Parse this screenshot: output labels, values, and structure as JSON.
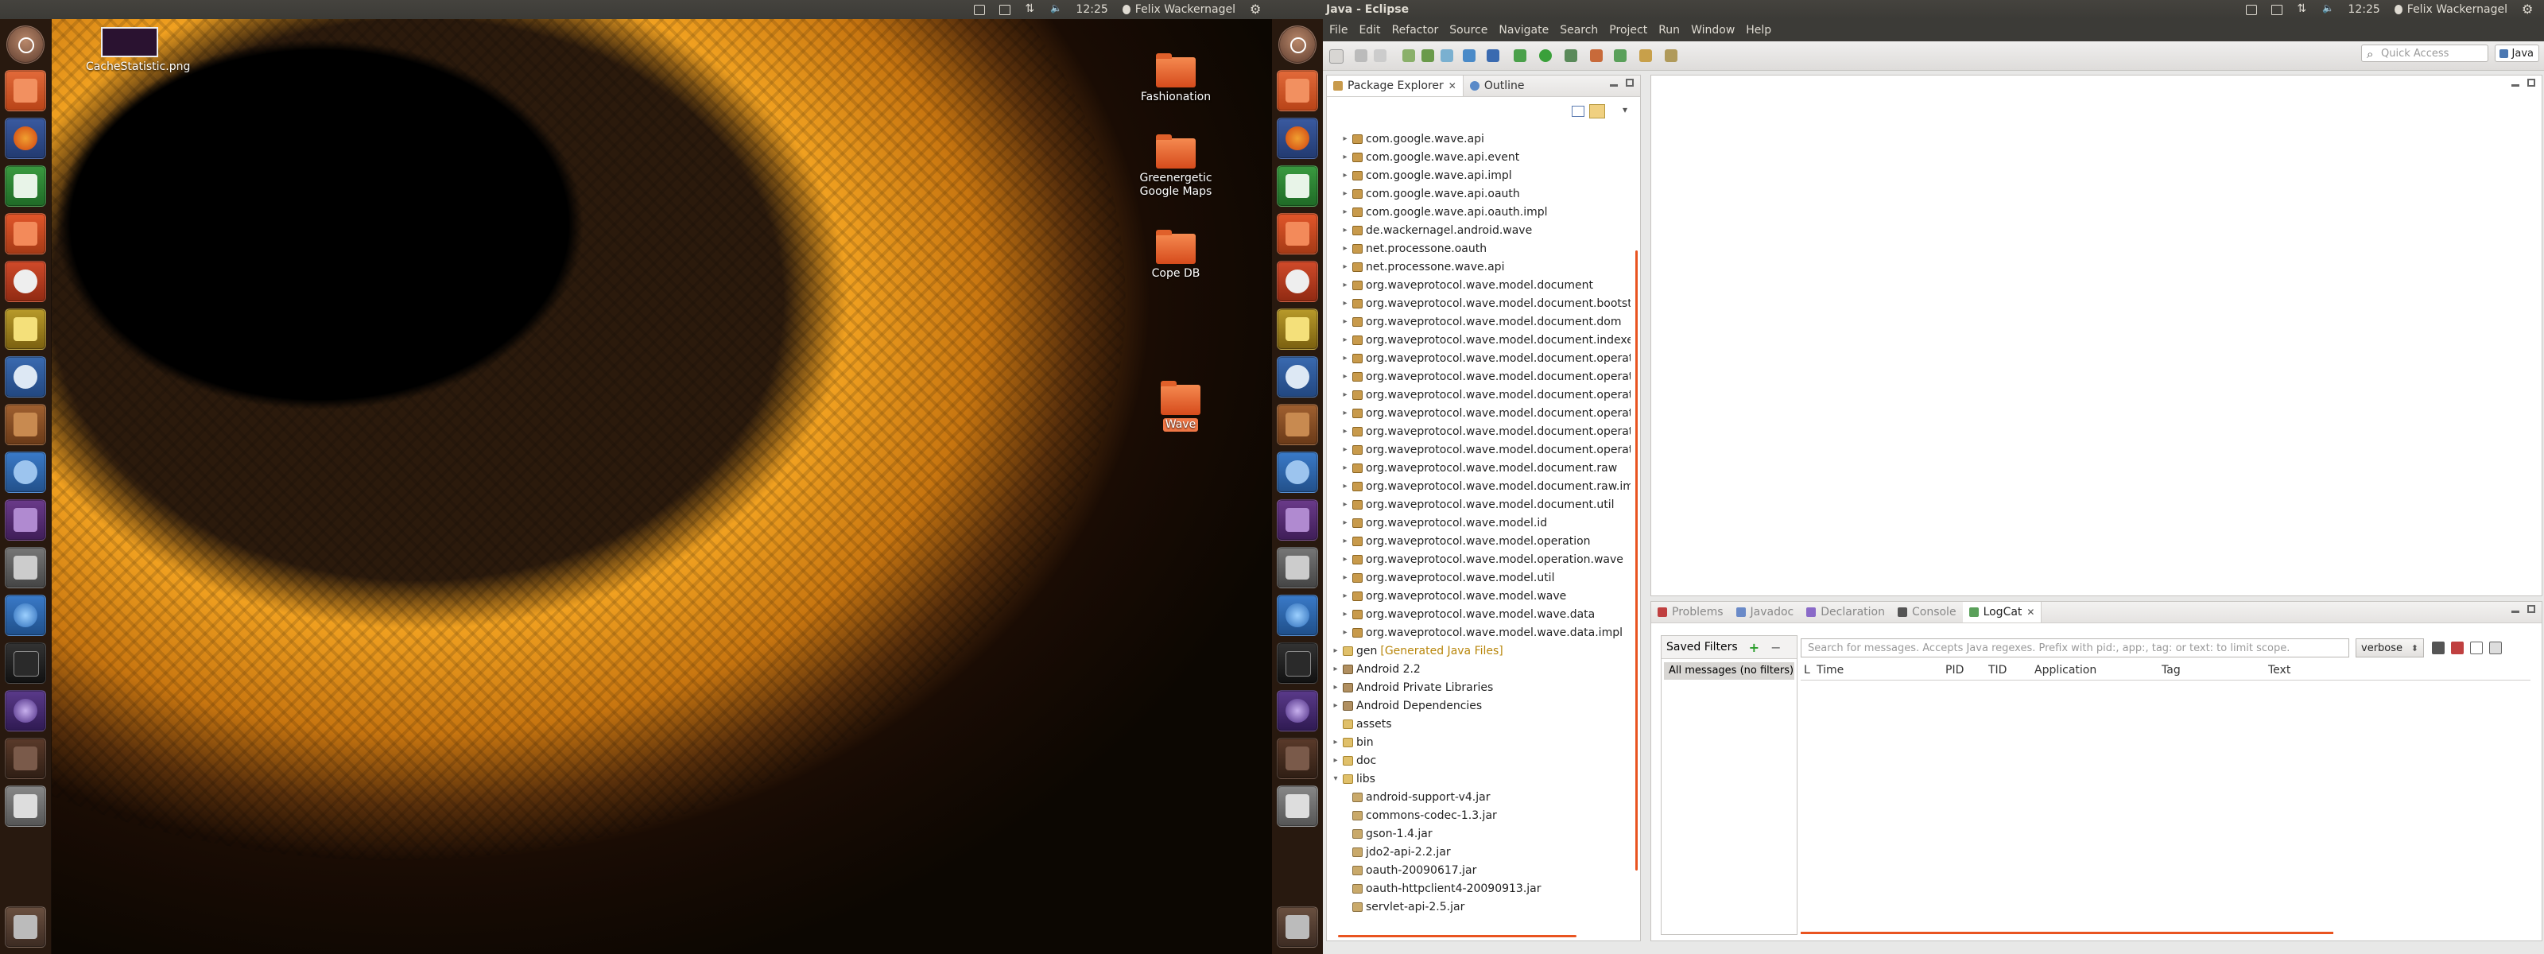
{
  "left_monitor": {
    "panel": {
      "clock": "12:25",
      "user": "Felix Wackernagel"
    },
    "desktop_icons": [
      {
        "label": "CacheStatistic.png",
        "type": "image"
      },
      {
        "label": "Fashionation",
        "type": "folder"
      },
      {
        "label": "Greenergetic Google Maps",
        "type": "folder"
      },
      {
        "label": "Cope DB",
        "type": "folder"
      },
      {
        "label": "Wave",
        "type": "folder",
        "selected": true
      }
    ]
  },
  "right_monitor": {
    "panel": {
      "window_title": "Java - Eclipse",
      "menus": [
        "File",
        "Edit",
        "Refactor",
        "Source",
        "Navigate",
        "Search",
        "Project",
        "Run",
        "Window",
        "Help"
      ],
      "clock": "12:25",
      "user": "Felix Wackernagel"
    },
    "toolbar": {
      "quick_access_placeholder": "Quick Access",
      "perspective": "Java"
    },
    "package_explorer": {
      "tabs": [
        "Package Explorer",
        "Outline"
      ],
      "tree": [
        {
          "label": "com.google.wave.api",
          "icon": "package",
          "indent": 1,
          "arrow": "▸"
        },
        {
          "label": "com.google.wave.api.event",
          "icon": "package",
          "indent": 1,
          "arrow": "▸"
        },
        {
          "label": "com.google.wave.api.impl",
          "icon": "package",
          "indent": 1,
          "arrow": "▸"
        },
        {
          "label": "com.google.wave.api.oauth",
          "icon": "package",
          "indent": 1,
          "arrow": "▸"
        },
        {
          "label": "com.google.wave.api.oauth.impl",
          "icon": "package",
          "indent": 1,
          "arrow": "▸"
        },
        {
          "label": "de.wackernagel.android.wave",
          "icon": "package",
          "indent": 1,
          "arrow": "▸"
        },
        {
          "label": "net.processone.oauth",
          "icon": "package",
          "indent": 1,
          "arrow": "▸"
        },
        {
          "label": "net.processone.wave.api",
          "icon": "package",
          "indent": 1,
          "arrow": "▸"
        },
        {
          "label": "org.waveprotocol.wave.model.document",
          "icon": "package",
          "indent": 1,
          "arrow": "▸"
        },
        {
          "label": "org.waveprotocol.wave.model.document.bootstr",
          "icon": "package",
          "indent": 1,
          "arrow": "▸"
        },
        {
          "label": "org.waveprotocol.wave.model.document.dom",
          "icon": "package",
          "indent": 1,
          "arrow": "▸"
        },
        {
          "label": "org.waveprotocol.wave.model.document.indexe",
          "icon": "package",
          "indent": 1,
          "arrow": "▸"
        },
        {
          "label": "org.waveprotocol.wave.model.document.operat",
          "icon": "package",
          "indent": 1,
          "arrow": "▸"
        },
        {
          "label": "org.waveprotocol.wave.model.document.operat",
          "icon": "package",
          "indent": 1,
          "arrow": "▸"
        },
        {
          "label": "org.waveprotocol.wave.model.document.operat",
          "icon": "package",
          "indent": 1,
          "arrow": "▸"
        },
        {
          "label": "org.waveprotocol.wave.model.document.operat",
          "icon": "package",
          "indent": 1,
          "arrow": "▸"
        },
        {
          "label": "org.waveprotocol.wave.model.document.operat",
          "icon": "package",
          "indent": 1,
          "arrow": "▸"
        },
        {
          "label": "org.waveprotocol.wave.model.document.operat",
          "icon": "package",
          "indent": 1,
          "arrow": "▸"
        },
        {
          "label": "org.waveprotocol.wave.model.document.raw",
          "icon": "package",
          "indent": 1,
          "arrow": "▸"
        },
        {
          "label": "org.waveprotocol.wave.model.document.raw.im",
          "icon": "package",
          "indent": 1,
          "arrow": "▸"
        },
        {
          "label": "org.waveprotocol.wave.model.document.util",
          "icon": "package",
          "indent": 1,
          "arrow": "▸"
        },
        {
          "label": "org.waveprotocol.wave.model.id",
          "icon": "package",
          "indent": 1,
          "arrow": "▸"
        },
        {
          "label": "org.waveprotocol.wave.model.operation",
          "icon": "package",
          "indent": 1,
          "arrow": "▸"
        },
        {
          "label": "org.waveprotocol.wave.model.operation.wave",
          "icon": "package",
          "indent": 1,
          "arrow": "▸"
        },
        {
          "label": "org.waveprotocol.wave.model.util",
          "icon": "package",
          "indent": 1,
          "arrow": "▸"
        },
        {
          "label": "org.waveprotocol.wave.model.wave",
          "icon": "package",
          "indent": 1,
          "arrow": "▸"
        },
        {
          "label": "org.waveprotocol.wave.model.wave.data",
          "icon": "package",
          "indent": 1,
          "arrow": "▸"
        },
        {
          "label": "org.waveprotocol.wave.model.wave.data.impl",
          "icon": "package",
          "indent": 1,
          "arrow": "▸"
        },
        {
          "label": "gen",
          "icon": "folder",
          "indent": 0,
          "arrow": "▸",
          "decoration": "[Generated Java Files]"
        },
        {
          "label": "Android 2.2",
          "icon": "library",
          "indent": 0,
          "arrow": "▸"
        },
        {
          "label": "Android Private Libraries",
          "icon": "library",
          "indent": 0,
          "arrow": "▸"
        },
        {
          "label": "Android Dependencies",
          "icon": "library",
          "indent": 0,
          "arrow": "▸"
        },
        {
          "label": "assets",
          "icon": "folder",
          "indent": 0,
          "arrow": ""
        },
        {
          "label": "bin",
          "icon": "folder",
          "indent": 0,
          "arrow": "▸"
        },
        {
          "label": "doc",
          "icon": "folder",
          "indent": 0,
          "arrow": "▸"
        },
        {
          "label": "libs",
          "icon": "folder",
          "indent": 0,
          "arrow": "▾"
        },
        {
          "label": "android-support-v4.jar",
          "icon": "jar",
          "indent": 1,
          "arrow": ""
        },
        {
          "label": "commons-codec-1.3.jar",
          "icon": "jar",
          "indent": 1,
          "arrow": ""
        },
        {
          "label": "gson-1.4.jar",
          "icon": "jar",
          "indent": 1,
          "arrow": ""
        },
        {
          "label": "jdo2-api-2.2.jar",
          "icon": "jar",
          "indent": 1,
          "arrow": ""
        },
        {
          "label": "oauth-20090617.jar",
          "icon": "jar",
          "indent": 1,
          "arrow": ""
        },
        {
          "label": "oauth-httpclient4-20090913.jar",
          "icon": "jar",
          "indent": 1,
          "arrow": ""
        },
        {
          "label": "servlet-api-2.5.jar",
          "icon": "jar",
          "indent": 1,
          "arrow": ""
        }
      ]
    },
    "bottom_panel": {
      "tabs": [
        "Problems",
        "Javadoc",
        "Declaration",
        "Console",
        "LogCat"
      ],
      "active_tab": "LogCat",
      "saved_filters_label": "Saved Filters",
      "all_messages": "All messages (no filters)",
      "search_placeholder": "Search for messages. Accepts Java regexes. Prefix with pid:, app:, tag: or text: to limit scope.",
      "log_level": "verbose",
      "columns": [
        "L",
        "Time",
        "PID",
        "TID",
        "Application",
        "Tag",
        "Text"
      ]
    }
  },
  "colors": {
    "accent": "#e95420",
    "panel": "#3c3b37",
    "eclipse_bg": "#e8e8e7"
  }
}
